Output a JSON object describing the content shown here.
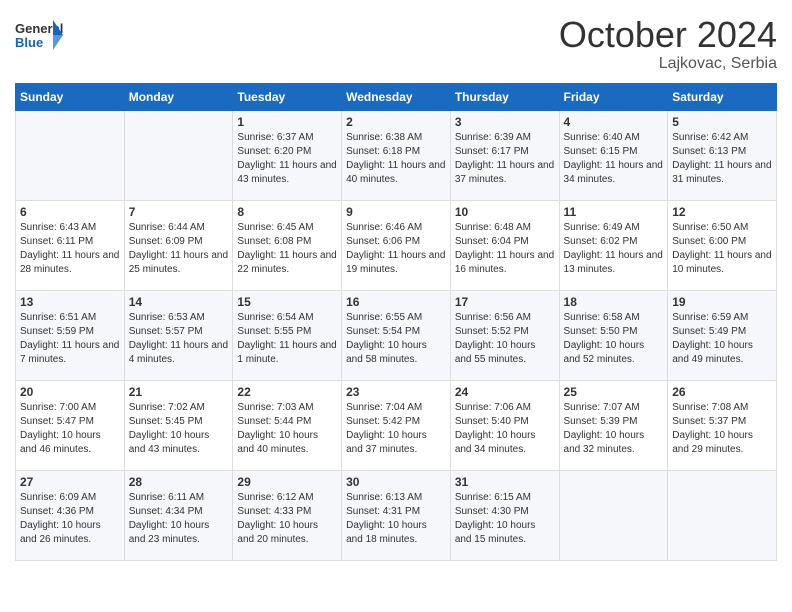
{
  "header": {
    "logo": {
      "text_general": "General",
      "text_blue": "Blue"
    },
    "title": "October 2024",
    "subtitle": "Lajkovac, Serbia"
  },
  "weekdays": [
    "Sunday",
    "Monday",
    "Tuesday",
    "Wednesday",
    "Thursday",
    "Friday",
    "Saturday"
  ],
  "weeks": [
    [
      null,
      null,
      {
        "day": 1,
        "sunrise": "Sunrise: 6:37 AM",
        "sunset": "Sunset: 6:20 PM",
        "daylight": "Daylight: 11 hours and 43 minutes."
      },
      {
        "day": 2,
        "sunrise": "Sunrise: 6:38 AM",
        "sunset": "Sunset: 6:18 PM",
        "daylight": "Daylight: 11 hours and 40 minutes."
      },
      {
        "day": 3,
        "sunrise": "Sunrise: 6:39 AM",
        "sunset": "Sunset: 6:17 PM",
        "daylight": "Daylight: 11 hours and 37 minutes."
      },
      {
        "day": 4,
        "sunrise": "Sunrise: 6:40 AM",
        "sunset": "Sunset: 6:15 PM",
        "daylight": "Daylight: 11 hours and 34 minutes."
      },
      {
        "day": 5,
        "sunrise": "Sunrise: 6:42 AM",
        "sunset": "Sunset: 6:13 PM",
        "daylight": "Daylight: 11 hours and 31 minutes."
      }
    ],
    [
      {
        "day": 6,
        "sunrise": "Sunrise: 6:43 AM",
        "sunset": "Sunset: 6:11 PM",
        "daylight": "Daylight: 11 hours and 28 minutes."
      },
      {
        "day": 7,
        "sunrise": "Sunrise: 6:44 AM",
        "sunset": "Sunset: 6:09 PM",
        "daylight": "Daylight: 11 hours and 25 minutes."
      },
      {
        "day": 8,
        "sunrise": "Sunrise: 6:45 AM",
        "sunset": "Sunset: 6:08 PM",
        "daylight": "Daylight: 11 hours and 22 minutes."
      },
      {
        "day": 9,
        "sunrise": "Sunrise: 6:46 AM",
        "sunset": "Sunset: 6:06 PM",
        "daylight": "Daylight: 11 hours and 19 minutes."
      },
      {
        "day": 10,
        "sunrise": "Sunrise: 6:48 AM",
        "sunset": "Sunset: 6:04 PM",
        "daylight": "Daylight: 11 hours and 16 minutes."
      },
      {
        "day": 11,
        "sunrise": "Sunrise: 6:49 AM",
        "sunset": "Sunset: 6:02 PM",
        "daylight": "Daylight: 11 hours and 13 minutes."
      },
      {
        "day": 12,
        "sunrise": "Sunrise: 6:50 AM",
        "sunset": "Sunset: 6:00 PM",
        "daylight": "Daylight: 11 hours and 10 minutes."
      }
    ],
    [
      {
        "day": 13,
        "sunrise": "Sunrise: 6:51 AM",
        "sunset": "Sunset: 5:59 PM",
        "daylight": "Daylight: 11 hours and 7 minutes."
      },
      {
        "day": 14,
        "sunrise": "Sunrise: 6:53 AM",
        "sunset": "Sunset: 5:57 PM",
        "daylight": "Daylight: 11 hours and 4 minutes."
      },
      {
        "day": 15,
        "sunrise": "Sunrise: 6:54 AM",
        "sunset": "Sunset: 5:55 PM",
        "daylight": "Daylight: 11 hours and 1 minute."
      },
      {
        "day": 16,
        "sunrise": "Sunrise: 6:55 AM",
        "sunset": "Sunset: 5:54 PM",
        "daylight": "Daylight: 10 hours and 58 minutes."
      },
      {
        "day": 17,
        "sunrise": "Sunrise: 6:56 AM",
        "sunset": "Sunset: 5:52 PM",
        "daylight": "Daylight: 10 hours and 55 minutes."
      },
      {
        "day": 18,
        "sunrise": "Sunrise: 6:58 AM",
        "sunset": "Sunset: 5:50 PM",
        "daylight": "Daylight: 10 hours and 52 minutes."
      },
      {
        "day": 19,
        "sunrise": "Sunrise: 6:59 AM",
        "sunset": "Sunset: 5:49 PM",
        "daylight": "Daylight: 10 hours and 49 minutes."
      }
    ],
    [
      {
        "day": 20,
        "sunrise": "Sunrise: 7:00 AM",
        "sunset": "Sunset: 5:47 PM",
        "daylight": "Daylight: 10 hours and 46 minutes."
      },
      {
        "day": 21,
        "sunrise": "Sunrise: 7:02 AM",
        "sunset": "Sunset: 5:45 PM",
        "daylight": "Daylight: 10 hours and 43 minutes."
      },
      {
        "day": 22,
        "sunrise": "Sunrise: 7:03 AM",
        "sunset": "Sunset: 5:44 PM",
        "daylight": "Daylight: 10 hours and 40 minutes."
      },
      {
        "day": 23,
        "sunrise": "Sunrise: 7:04 AM",
        "sunset": "Sunset: 5:42 PM",
        "daylight": "Daylight: 10 hours and 37 minutes."
      },
      {
        "day": 24,
        "sunrise": "Sunrise: 7:06 AM",
        "sunset": "Sunset: 5:40 PM",
        "daylight": "Daylight: 10 hours and 34 minutes."
      },
      {
        "day": 25,
        "sunrise": "Sunrise: 7:07 AM",
        "sunset": "Sunset: 5:39 PM",
        "daylight": "Daylight: 10 hours and 32 minutes."
      },
      {
        "day": 26,
        "sunrise": "Sunrise: 7:08 AM",
        "sunset": "Sunset: 5:37 PM",
        "daylight": "Daylight: 10 hours and 29 minutes."
      }
    ],
    [
      {
        "day": 27,
        "sunrise": "Sunrise: 6:09 AM",
        "sunset": "Sunset: 4:36 PM",
        "daylight": "Daylight: 10 hours and 26 minutes."
      },
      {
        "day": 28,
        "sunrise": "Sunrise: 6:11 AM",
        "sunset": "Sunset: 4:34 PM",
        "daylight": "Daylight: 10 hours and 23 minutes."
      },
      {
        "day": 29,
        "sunrise": "Sunrise: 6:12 AM",
        "sunset": "Sunset: 4:33 PM",
        "daylight": "Daylight: 10 hours and 20 minutes."
      },
      {
        "day": 30,
        "sunrise": "Sunrise: 6:13 AM",
        "sunset": "Sunset: 4:31 PM",
        "daylight": "Daylight: 10 hours and 18 minutes."
      },
      {
        "day": 31,
        "sunrise": "Sunrise: 6:15 AM",
        "sunset": "Sunset: 4:30 PM",
        "daylight": "Daylight: 10 hours and 15 minutes."
      },
      null,
      null
    ]
  ]
}
